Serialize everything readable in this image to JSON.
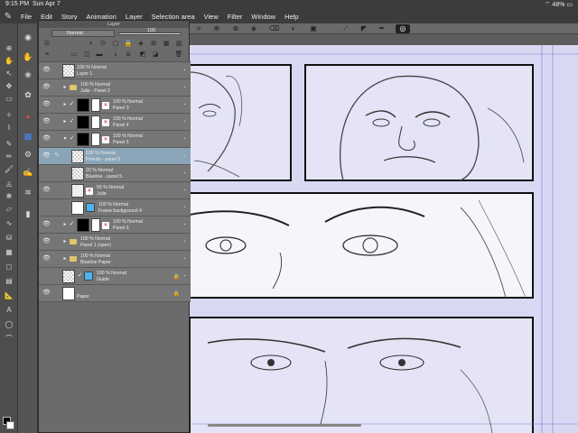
{
  "status": {
    "time": "9:15 PM",
    "date": "Sun Apr 7",
    "battery": "48%"
  },
  "menu": {
    "items": [
      "File",
      "Edit",
      "Story",
      "Animation",
      "Layer",
      "Selection area",
      "View",
      "Filter",
      "Window",
      "Help"
    ]
  },
  "layer_panel": {
    "title": "Layer",
    "blend_mode": "Normal",
    "opacity": "100",
    "layers": [
      {
        "name": "Layer 1",
        "mode": "100 % Normal",
        "type": "raster",
        "visible": true,
        "selected": false
      },
      {
        "name": "Julie - Panel 2",
        "mode": "100 % Normal",
        "type": "folder",
        "visible": true,
        "selected": false
      },
      {
        "name": "Panel 3",
        "mode": "100 % Normal",
        "type": "panel",
        "visible": true,
        "selected": false
      },
      {
        "name": "Panel 4",
        "mode": "100 % Normal",
        "type": "panel",
        "visible": true,
        "selected": false
      },
      {
        "name": "Panel 5",
        "mode": "100 % Normal",
        "type": "panel",
        "visible": true,
        "selected": false
      },
      {
        "name": "Pencils - panel 5",
        "mode": "100 % Normal",
        "type": "raster",
        "visible": true,
        "selected": true
      },
      {
        "name": "Blueline - panel 5",
        "mode": "20 % Normal",
        "type": "raster",
        "visible": false,
        "selected": false
      },
      {
        "name": "Julie",
        "mode": "50 % Normal",
        "type": "sketch",
        "visible": true,
        "selected": false
      },
      {
        "name": "Frame background 4",
        "mode": "100 % Normal",
        "type": "fill",
        "visible": true,
        "selected": false
      },
      {
        "name": "Panel 6",
        "mode": "100 % Normal",
        "type": "panel",
        "visible": true,
        "selected": false
      },
      {
        "name": "Panel 1 (open)",
        "mode": "100 % Normal",
        "type": "folder",
        "visible": true,
        "selected": false
      },
      {
        "name": "Blueline Paper",
        "mode": "100 % Normal",
        "type": "folder",
        "visible": true,
        "selected": false
      },
      {
        "name": "Guide",
        "mode": "100 % Normal",
        "type": "guide",
        "visible": true,
        "selected": false
      },
      {
        "name": "Paper",
        "mode": "",
        "type": "paper",
        "visible": true,
        "selected": false
      }
    ]
  },
  "colors": {
    "canvas_bg": "#d8d8f2",
    "selected_layer": "#8aa5b8",
    "folder": "#e0c56c",
    "panel": "#6b6b6b"
  }
}
